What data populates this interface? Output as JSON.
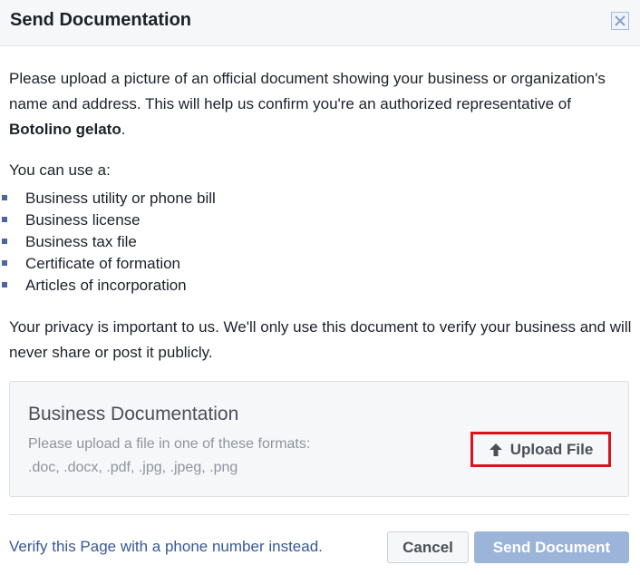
{
  "dialog": {
    "title": "Send Documentation",
    "close_icon": "close-icon"
  },
  "intro": {
    "text_before": "Please upload a picture of an official document showing your business or organization's name and address. This will help us confirm you're an authorized representative of ",
    "business_name": "Botolino gelato",
    "text_after": "."
  },
  "use_label": "You can use a:",
  "documents": [
    "Business utility or phone bill",
    "Business license",
    "Business tax file",
    "Certificate of formation",
    "Articles of incorporation"
  ],
  "privacy": "Your privacy is important to us. We'll only use this document to verify your business and will never share or post it publicly.",
  "upload_panel": {
    "title": "Business Documentation",
    "hint_line1": "Please upload a file in one of these formats:",
    "hint_line2": ".doc, .docx, .pdf, .jpg, .jpeg, .png",
    "upload_label": "Upload File",
    "upload_icon": "upload-arrow-icon",
    "highlight_color": "#d9141b"
  },
  "footer": {
    "phone_link": "Verify this Page with a phone number instead.",
    "cancel_label": "Cancel",
    "send_label": "Send Document"
  },
  "colors": {
    "link": "#365899",
    "primary_disabled": "#9cb4d8",
    "header_bg": "#f6f7f9"
  }
}
